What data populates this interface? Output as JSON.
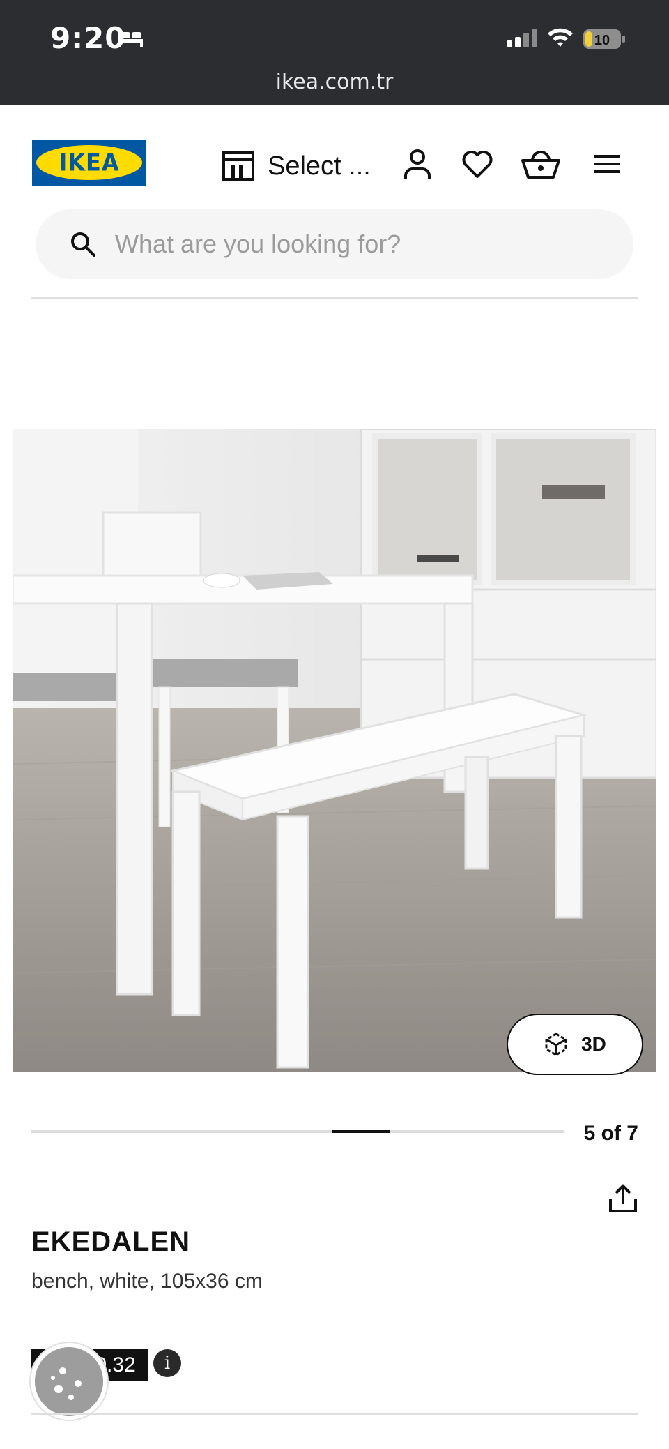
{
  "status_bar": {
    "time": "9:20",
    "battery": "10"
  },
  "browser": {
    "url": "ikea.com.tr"
  },
  "header": {
    "logo_text": "IKEA",
    "store_label": "Select ..."
  },
  "search": {
    "placeholder": "What are you looking for?"
  },
  "gallery": {
    "button_3d": "3D",
    "counter": "5 of 7",
    "current": 5,
    "total": 7
  },
  "product": {
    "name": "EKEDALEN",
    "description": "bench, white, 105x36 cm",
    "price": "410.32"
  },
  "icons": [
    "bed-icon",
    "signal-icon",
    "wifi-icon",
    "battery-icon",
    "store-icon",
    "user-icon",
    "heart-icon",
    "basket-icon",
    "menu-icon",
    "search-icon",
    "cube-icon",
    "share-icon",
    "info-icon",
    "cookie-icon"
  ],
  "colors": {
    "ikea_blue": "#0058a3",
    "ikea_yellow": "#ffdb00",
    "status_bar": "#2b2d30"
  }
}
